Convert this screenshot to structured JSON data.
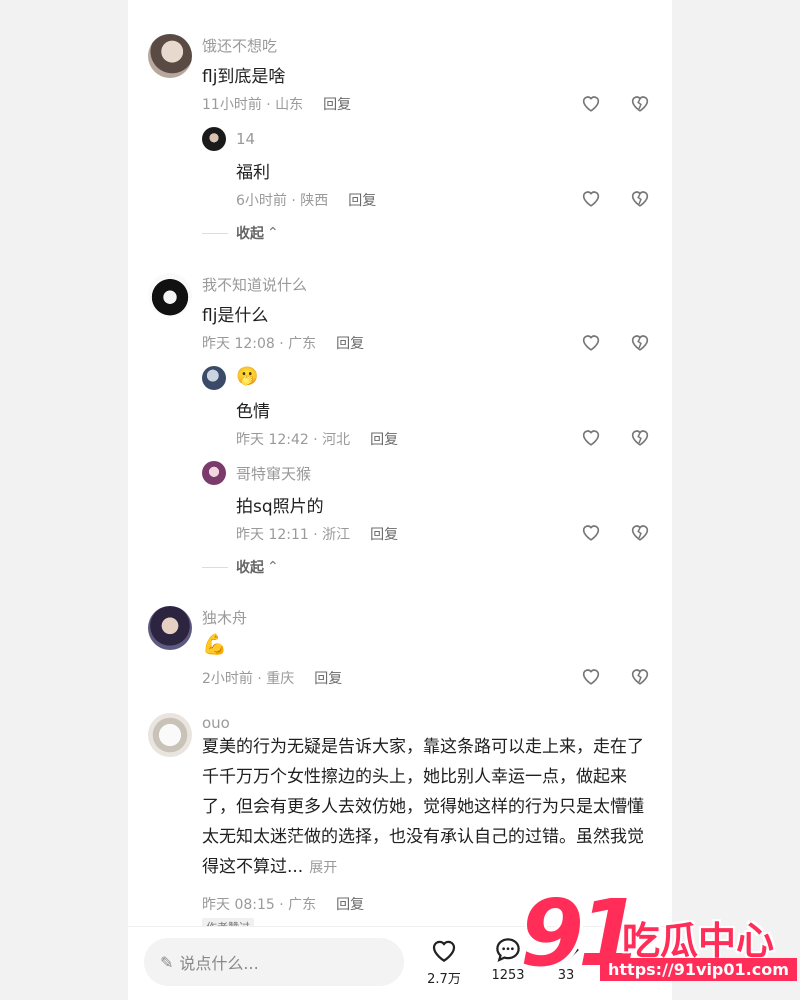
{
  "comments": [
    {
      "user": "饿还不想吃",
      "text": "flj到底是啥",
      "time": "11小时前 · 山东",
      "reply": "回复",
      "replies": [
        {
          "user": "14",
          "text": "福利",
          "time": "6小时前 · 陕西",
          "reply": "回复"
        }
      ],
      "collapse": "收起"
    },
    {
      "user": "我不知道说什么",
      "text": "flj是什么",
      "time": "昨天 12:08 · 广东",
      "reply": "回复",
      "replies": [
        {
          "user": "🫢",
          "text": "色情",
          "time": "昨天 12:42 · 河北",
          "reply": "回复"
        },
        {
          "user": "哥特窜天猴",
          "text": "拍sq照片的",
          "time": "昨天 12:11 · 浙江",
          "reply": "回复"
        }
      ],
      "collapse": "收起"
    },
    {
      "user": "独木舟",
      "text": "💪",
      "time": "2小时前 · 重庆",
      "reply": "回复"
    },
    {
      "user": "ouo",
      "text": "夏美的行为无疑是告诉大家，靠这条路可以走上来，走在了千千万万个女性擦边的头上，她比别人幸运一点，做起来了，但会有更多人去效仿她，觉得她这样的行为只是太懵懂太无知太迷茫做的选择，也没有承认自己的过错。虽然我觉得这不算过...",
      "expand": "展开",
      "time": "昨天 08:15 · 广东",
      "reply": "回复",
      "author_tag": "作者赞过"
    }
  ],
  "bottom": {
    "placeholder": "说点什么...",
    "likes": "2.7万",
    "comments": "1253",
    "shares": "33"
  },
  "watermark": {
    "number": "91",
    "name": "吃瓜中心",
    "url": "https://91vip01.com"
  }
}
